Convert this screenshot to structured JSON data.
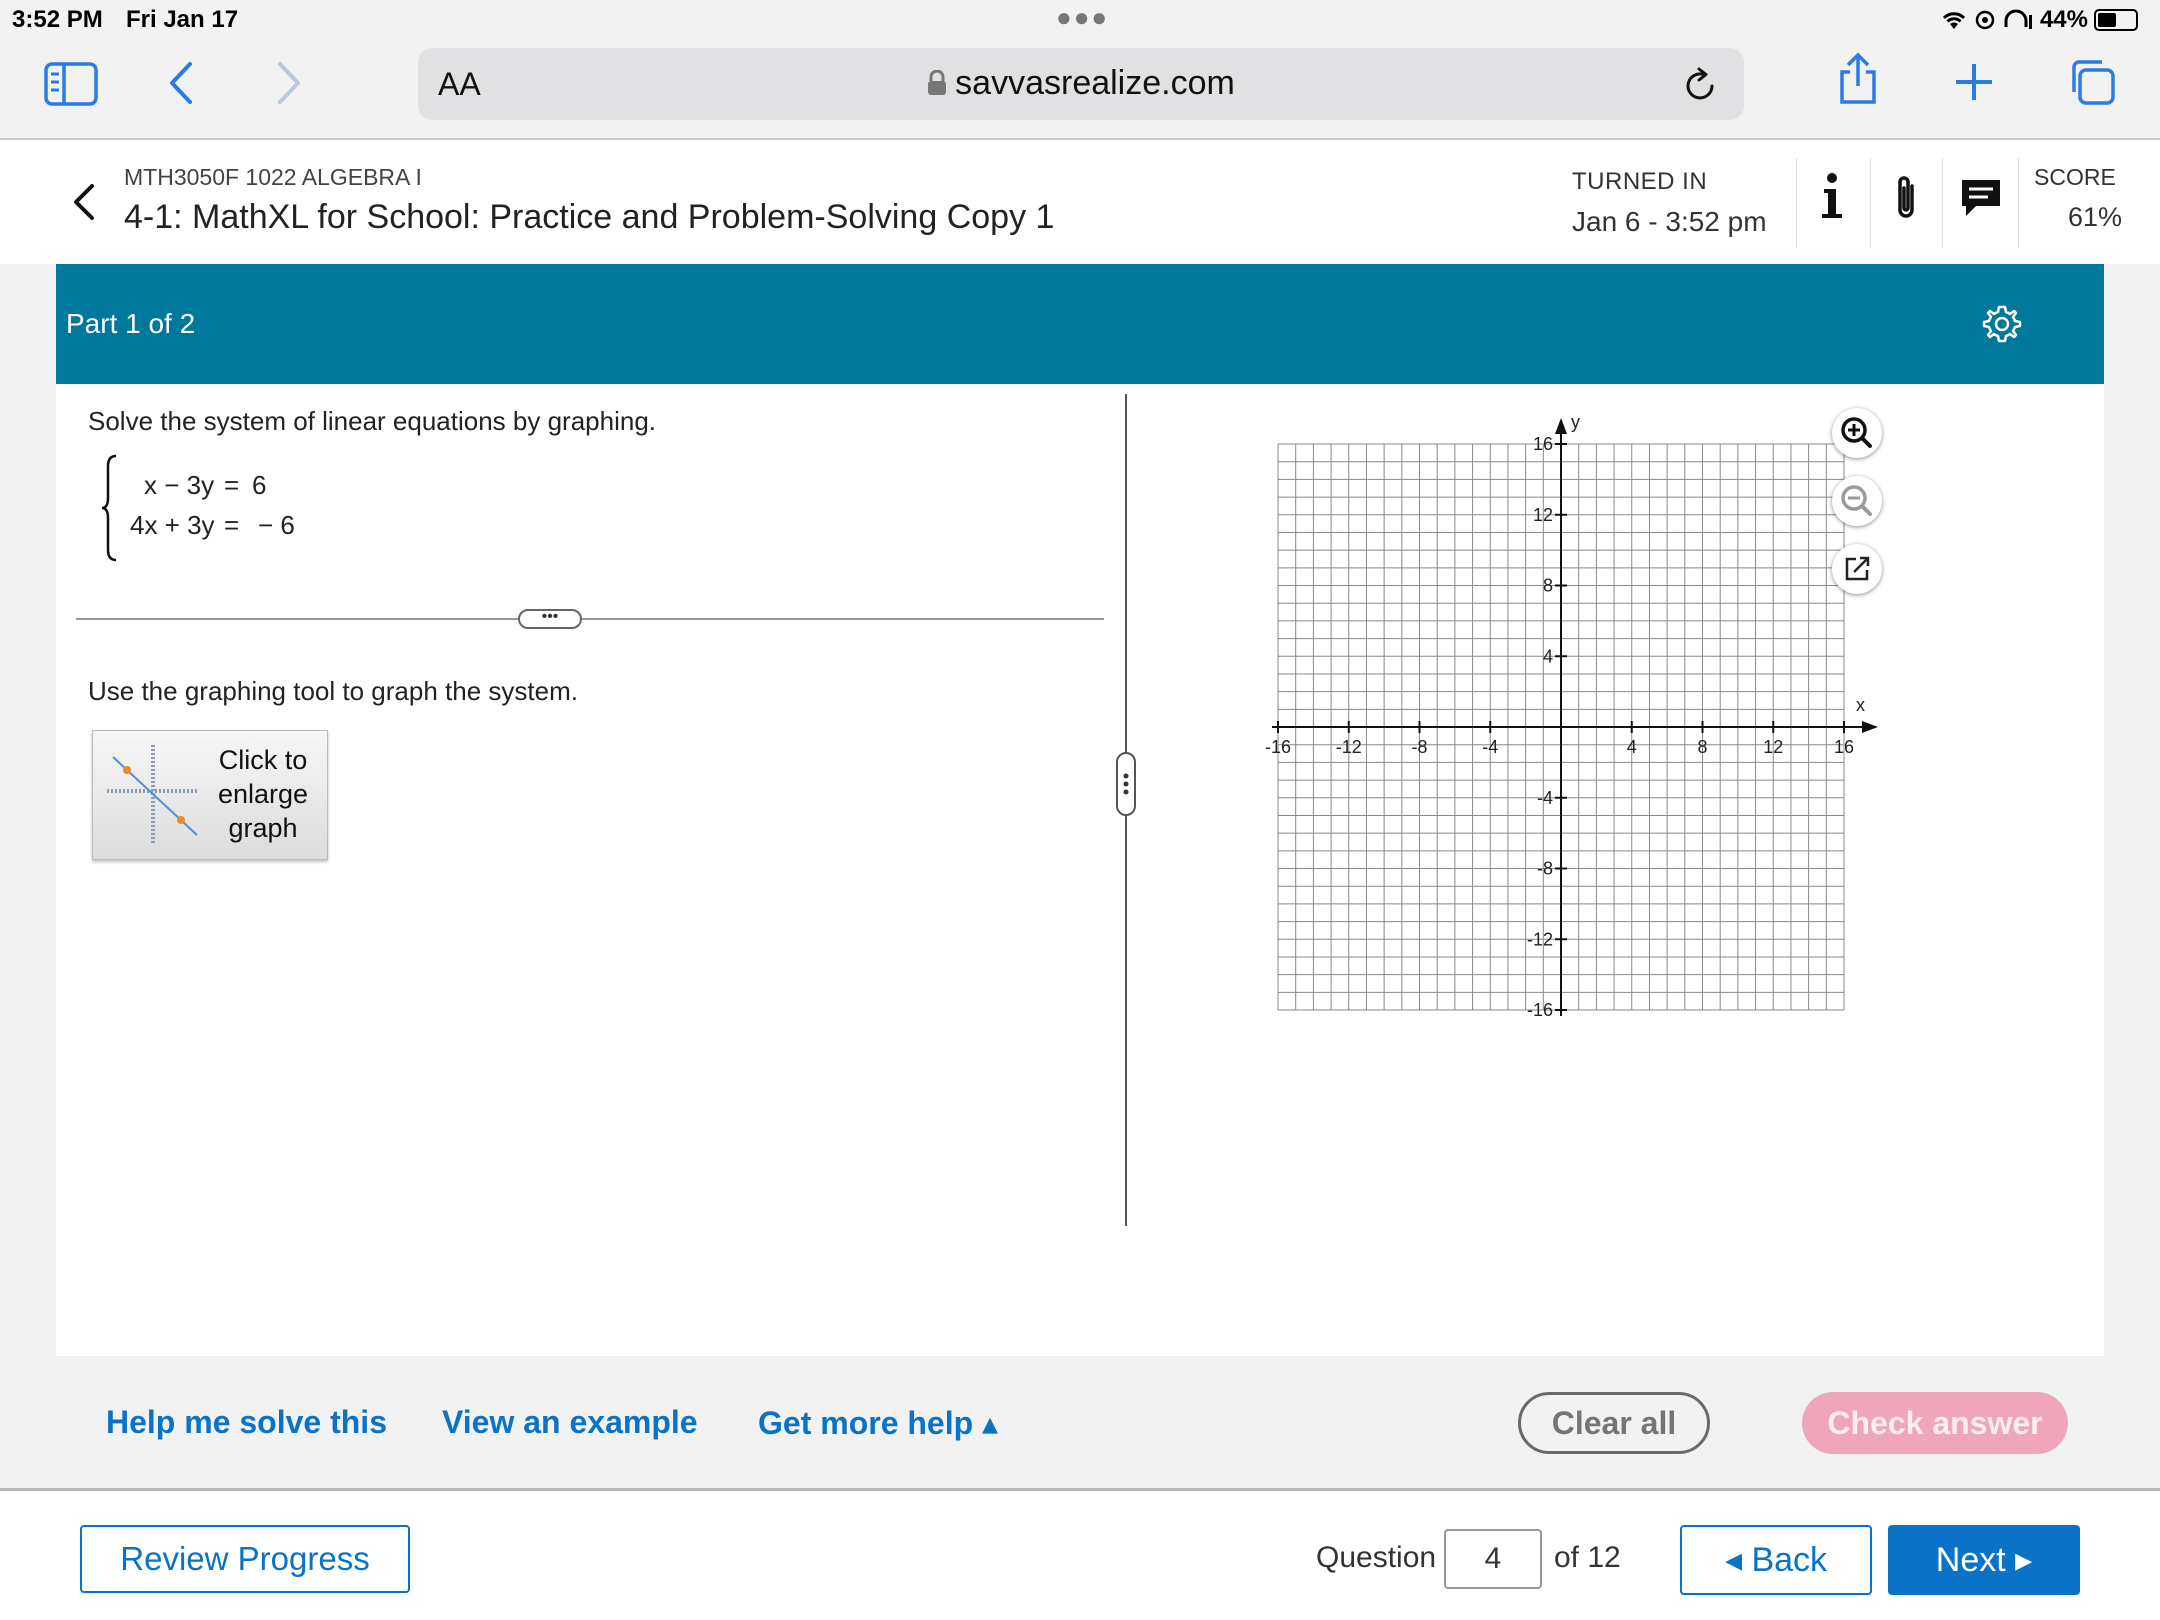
{
  "status_bar": {
    "time": "3:52 PM",
    "date": "Fri Jan 17",
    "battery": "44%",
    "battery_level": 0.44
  },
  "browser": {
    "aa_label": "AA",
    "url": "savvasrealize.com"
  },
  "assignment": {
    "course": "MTH3050F 1022 ALGEBRA I",
    "title": "4-1: MathXL for School: Practice and Problem-Solving Copy 1",
    "turned_in_label": "TURNED IN",
    "turned_in_date": "Jan 6 - 3:52 pm",
    "score_label": "SCORE",
    "score_value": "61%"
  },
  "part": {
    "label": "Part 1 of 2"
  },
  "question": {
    "prompt": "Solve the system of linear equations by graphing.",
    "equations": [
      {
        "lhs": "x − 3y",
        "eq": "=",
        "rhs": "6"
      },
      {
        "lhs": "4x + 3y",
        "eq": "=",
        "rhs": "− 6"
      }
    ],
    "expand_label": "•••",
    "instruction": "Use the graphing tool to graph the system.",
    "enlarge_label": "Click to enlarge graph"
  },
  "graph": {
    "x_axis_label": "x",
    "y_axis_label": "y",
    "x_min": -16,
    "x_max": 16,
    "y_min": -16,
    "y_max": 16,
    "grid_step": 1,
    "x_tick_labels": [
      "-16",
      "-12",
      "-8",
      "-4",
      "4",
      "8",
      "12",
      "16"
    ],
    "y_tick_labels": [
      "16",
      "12",
      "8",
      "4",
      "-4",
      "-8",
      "-12",
      "-16"
    ]
  },
  "help": {
    "help_me_solve": "Help me solve this",
    "view_example": "View an example",
    "get_more_help": "Get more help ▴",
    "clear_all": "Clear all",
    "check_answer": "Check answer"
  },
  "footer": {
    "review_progress": "Review Progress",
    "question_label": "Question",
    "question_number": "4",
    "question_total": "of 12",
    "back": "◂ Back",
    "next": "Next ▸"
  },
  "colors": {
    "accent": "#0a73c8",
    "part_bar": "#00789c",
    "check_answer_disabled": "#f0a6ba"
  }
}
